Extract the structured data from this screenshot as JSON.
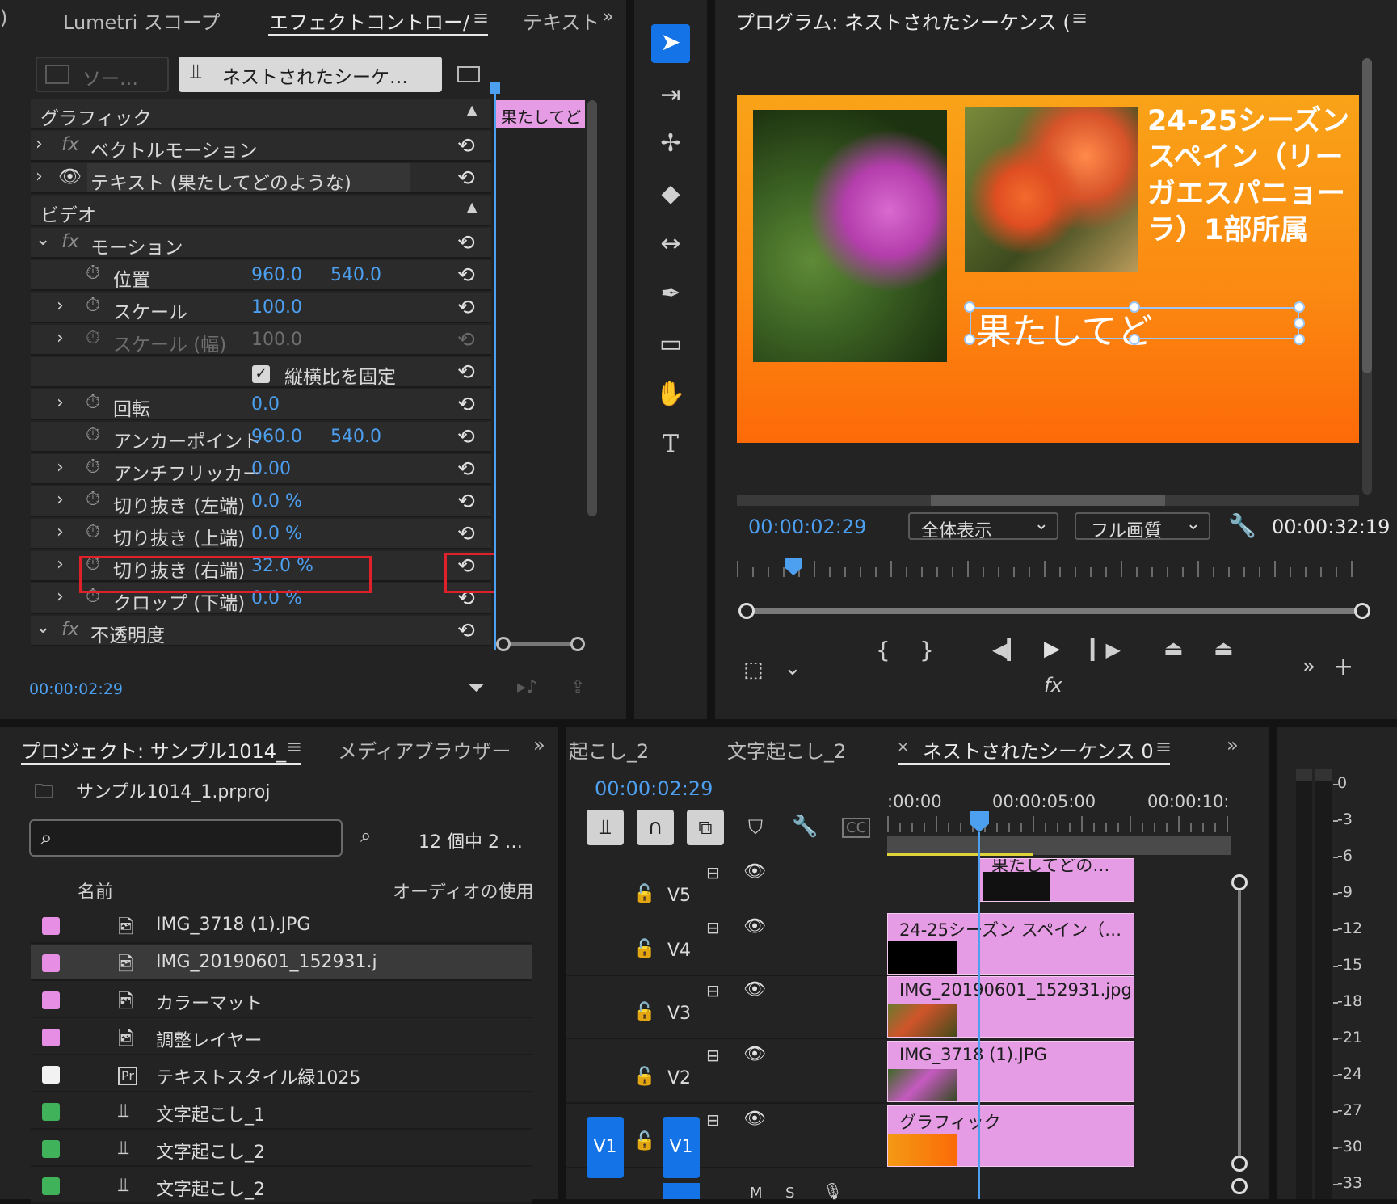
{
  "effect_panel": {
    "tabs": [
      "Lumetri スコープ",
      "エフェクトコントロー/",
      "テキスト"
    ],
    "src_tab": "ソー…",
    "seq_tab": "ネストされたシーケ…",
    "clip_label": "果たしてど",
    "graphic_header": "グラフィック",
    "vector_motion": "ベクトルモーション",
    "text_layer": "テキスト (果たしてどのような)",
    "video_header": "ビデオ",
    "motion": "モーション",
    "props": [
      {
        "label": "位置",
        "v1": "960.0",
        "v2": "540.0"
      },
      {
        "label": "スケール",
        "v1": "100.0",
        "v2": ""
      },
      {
        "label": "スケール (幅)",
        "v1": "100.0",
        "v2": ""
      },
      {
        "label": "縦横比を固定",
        "v1": "",
        "v2": ""
      },
      {
        "label": "回転",
        "v1": "0.0",
        "v2": ""
      },
      {
        "label": "アンカーポイント",
        "v1": "960.0",
        "v2": "540.0"
      },
      {
        "label": "アンチフリッカー",
        "v1": "0.00",
        "v2": ""
      },
      {
        "label": "切り抜き (左端)",
        "v1": "0.0 %",
        "v2": ""
      },
      {
        "label": "切り抜き (上端)",
        "v1": "0.0 %",
        "v2": ""
      },
      {
        "label": "切り抜き (右端)",
        "v1": "32.0 %",
        "v2": ""
      },
      {
        "label": "クロップ (下端)",
        "v1": "0.0 %",
        "v2": ""
      }
    ],
    "opacity": "不透明度",
    "timecode": "00:00:02:29"
  },
  "program": {
    "title": "プログラム: ネストされたシーケンス (",
    "overlay_text": "24-25シーズン スペイン（リー ガエスパニョー ラ）1部所属",
    "overlay_lines": [
      "24-25シーズン",
      "スペイン（リー",
      "ガエスパニョー",
      "ラ）1部所属"
    ],
    "edit_text": "果たしてど",
    "timecode": "00:00:02:29",
    "fit": "全体表示",
    "quality": "フル画質",
    "duration": "00:00:32:19"
  },
  "project": {
    "tabs": [
      "プロジェクト: サンプル1014_",
      "メディアブラウザー"
    ],
    "file": "サンプル1014_1.prproj",
    "count": "12 個中 2 …",
    "col_name": "名前",
    "col_audio": "オーディオの使用",
    "items": [
      {
        "name": "IMG_3718 (1).JPG",
        "color": "#e58ee3"
      },
      {
        "name": "IMG_20190601_152931.j",
        "color": "#e58ee3"
      },
      {
        "name": "カラーマット",
        "color": "#e58ee3"
      },
      {
        "name": "調整レイヤー",
        "color": "#e58ee3"
      },
      {
        "name": "テキストスタイル緑1025",
        "color": "#f2f2f2"
      },
      {
        "name": "文字起こし_1",
        "color": "#3fb25a"
      },
      {
        "name": "文字起こし_2",
        "color": "#3fb25a"
      },
      {
        "name": "文字起こし_2",
        "color": "#3fb25a"
      }
    ]
  },
  "timeline": {
    "tabs": [
      "起こし_2",
      "文字起こし_2",
      "ネストされたシーケンス 0"
    ],
    "timecode": "00:00:02:29",
    "ruler": [
      ":00:00",
      "00:00:05:00",
      "00:00:10:"
    ],
    "tracks": [
      "V5",
      "V4",
      "V3",
      "V2",
      "V1"
    ],
    "source_track": "V1",
    "clips": [
      "果たしてどの…",
      "24-25シーズン スペイン（…",
      "IMG_20190601_152931.jpg",
      "IMG_3718 (1).JPG",
      "グラフィック"
    ],
    "bottom_labels": [
      "M",
      "S"
    ]
  },
  "meter": {
    "labels": [
      "0",
      "-3",
      "-6",
      "-9",
      "-12",
      "-15",
      "-18",
      "-21",
      "-24",
      "-27",
      "-30",
      "-33"
    ]
  },
  "colors": {
    "accent": "#4d9ff0",
    "clip": "#e69ce4",
    "highlight": "#e0202a",
    "select": "#1473e6"
  }
}
